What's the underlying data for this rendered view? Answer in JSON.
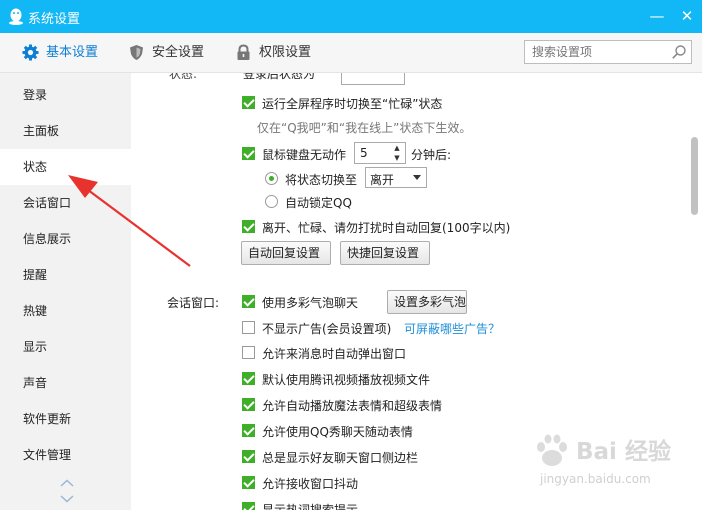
{
  "window": {
    "title": "系统设置",
    "minimize_glyph": "—",
    "close_glyph": "✕"
  },
  "toolbar": {
    "tabs": [
      {
        "label": "基本设置",
        "icon": "gear-icon",
        "active": true
      },
      {
        "label": "安全设置",
        "icon": "shield-icon",
        "active": false
      },
      {
        "label": "权限设置",
        "icon": "lock-icon",
        "active": false
      }
    ],
    "search_placeholder": "搜索设置项"
  },
  "sidebar": {
    "items": [
      "登录",
      "主面板",
      "状态",
      "会话窗口",
      "信息展示",
      "提醒",
      "热键",
      "显示",
      "声音",
      "软件更新",
      "文件管理"
    ],
    "active": "状态"
  },
  "status": {
    "cut_label": "状态:",
    "cut_text": "登录后状态为",
    "fullscreen_busy": {
      "label": "运行全屏程序时切换至“忙碌”状态",
      "checked": true
    },
    "fullscreen_hint": "仅在“Q我吧”和“我在线上”状态下生效。",
    "idle": {
      "label_before": "鼠标键盘无动作",
      "minutes": "5",
      "label_after": "分钟后:",
      "checked": true
    },
    "switch_to": {
      "label": "将状态切换至",
      "value": "离开",
      "selected": true
    },
    "auto_lock": {
      "label": "自动锁定QQ",
      "selected": false
    },
    "auto_reply": {
      "label": "离开、忙碌、请勿打扰时自动回复(100字以内)",
      "checked": true
    },
    "btn_auto_reply": "自动回复设置",
    "btn_quick_reply": "快捷回复设置"
  },
  "chat_window": {
    "section_label": "会话窗口:",
    "options": [
      {
        "label": "使用多彩气泡聊天",
        "checked": true
      },
      {
        "label": "不显示广告(会员设置项)",
        "checked": false
      },
      {
        "label": "允许来消息时自动弹出窗口",
        "checked": false
      },
      {
        "label": "默认使用腾讯视频播放视频文件",
        "checked": true
      },
      {
        "label": "允许自动播放魔法表情和超级表情",
        "checked": true
      },
      {
        "label": "允许使用QQ秀聊天随动表情",
        "checked": true
      },
      {
        "label": "总是显示好友聊天窗口侧边栏",
        "checked": true
      },
      {
        "label": "允许接收窗口抖动",
        "checked": true
      },
      {
        "label": "显示热词搜索提示",
        "checked": true
      }
    ],
    "bubble_button": "设置多彩气泡",
    "ad_link": "可屏蔽哪些广告？"
  },
  "watermark": {
    "brand": "Bai 经验",
    "url": "jingyan.baidu.com"
  },
  "colors": {
    "titlebar": "#12b7f5",
    "accent": "#0f7fd4",
    "check_green": "#3fae29",
    "annotation_arrow": "#e8322e"
  }
}
